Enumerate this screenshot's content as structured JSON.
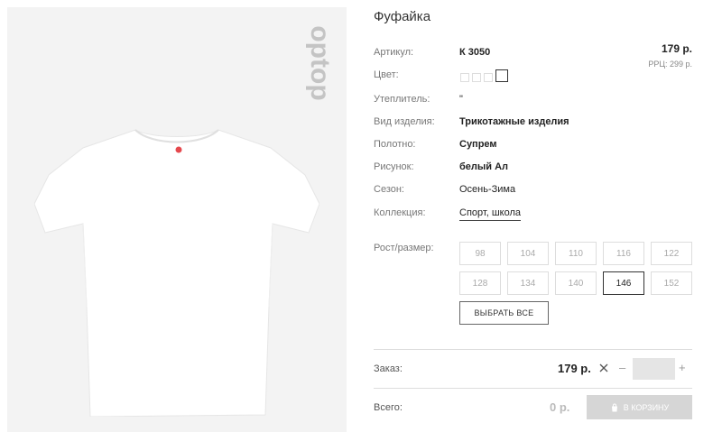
{
  "product": {
    "title": "Фуфайка",
    "brand_logo_text": "optop",
    "image": "white-tshirt"
  },
  "attributes": {
    "article": {
      "label": "Артикул:",
      "value": "К 3050"
    },
    "color": {
      "label": "Цвет:",
      "swatches": 4,
      "active_index": 3
    },
    "insulation": {
      "label": "Утеплитель:",
      "value": "\""
    },
    "product_type": {
      "label": "Вид изделия:",
      "value": "Трикотажные изделия"
    },
    "fabric": {
      "label": "Полотно:",
      "value": "Супрем"
    },
    "print": {
      "label": "Рисунок:",
      "value": "белый Ал"
    },
    "season": {
      "label": "Сезон:",
      "value": "Осень-Зима"
    },
    "collection": {
      "label": "Коллекция:",
      "value": "Спорт, школа"
    }
  },
  "pricing": {
    "price": "179 р.",
    "rrp": "РРЦ: 299 р."
  },
  "sizes": {
    "label": "Рост/размер:",
    "options": [
      "98",
      "104",
      "110",
      "116",
      "122",
      "128",
      "134",
      "140",
      "146",
      "152"
    ],
    "selected": "146",
    "select_all_label": "ВЫБРАТЬ ВСЕ"
  },
  "order": {
    "label": "Заказ:",
    "price": "179 р.",
    "remove_icon": "close-icon",
    "minus": "–",
    "plus": "+",
    "quantity": ""
  },
  "total": {
    "label": "Всего:",
    "value": "0 р.",
    "cart_button_label": "В КОРЗИНУ",
    "cart_icon": "bag-icon"
  },
  "colors": {
    "panel_bg": "#f3f3f3",
    "accent": "#e5484d",
    "button_disabled": "#d6d6d6"
  }
}
